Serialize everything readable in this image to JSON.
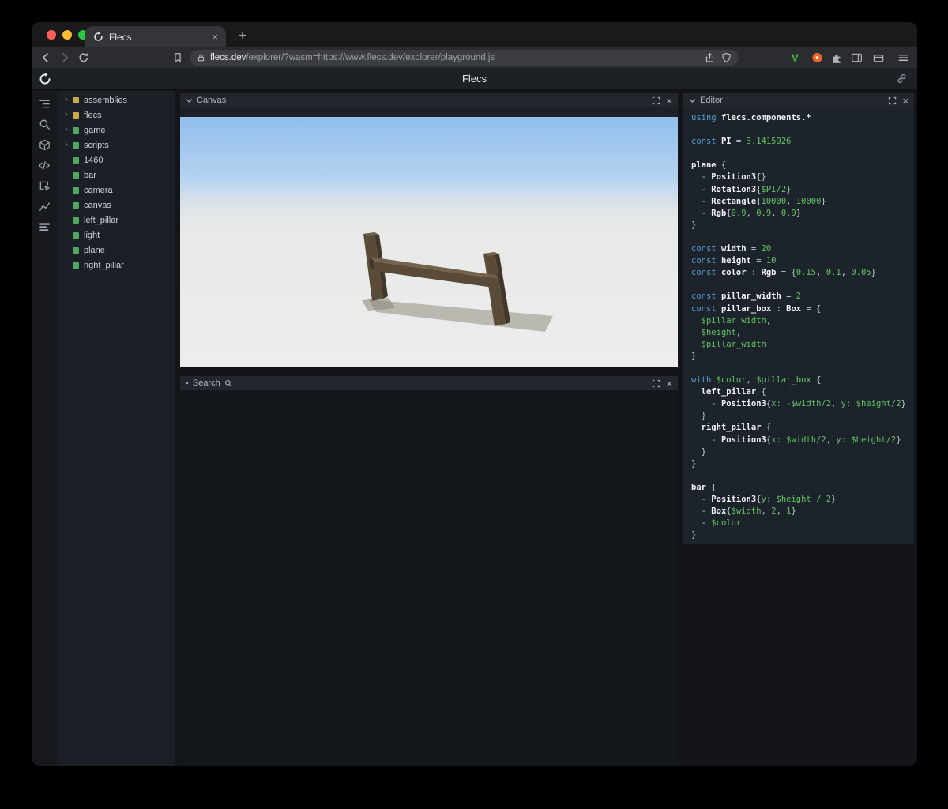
{
  "window": {
    "tab_title": "Flecs",
    "url_domain": "flecs.dev",
    "url_path": "/explorer/?wasm=https://www.flecs.dev/explorer/playground.js"
  },
  "icons": {
    "close": "×",
    "plus": "+",
    "bullet": "•",
    "chevron_right": "›",
    "v_extension": "V"
  },
  "colors": {
    "traffic_red": "#ff5f57",
    "traffic_yellow": "#febc2e",
    "traffic_green": "#28c840",
    "module_yellow": "#c9a94a",
    "entity_green": "#4fa85d",
    "accent_keyword": "#569cd6",
    "accent_value": "#62c462"
  },
  "app": {
    "title": "Flecs"
  },
  "panels": {
    "canvas": {
      "title": "Canvas"
    },
    "search": {
      "title": "Search"
    },
    "editor": {
      "title": "Editor"
    }
  },
  "tree": {
    "items": [
      {
        "label": "assemblies",
        "expandable": true,
        "color": "#c9a94a"
      },
      {
        "label": "flecs",
        "expandable": true,
        "color": "#c9a94a"
      },
      {
        "label": "game",
        "expandable": true,
        "color": "#4fa85d"
      },
      {
        "label": "scripts",
        "expandable": true,
        "color": "#4fa85d"
      },
      {
        "label": "1460",
        "expandable": false,
        "color": "#4fa85d"
      },
      {
        "label": "bar",
        "expandable": false,
        "color": "#4fa85d"
      },
      {
        "label": "camera",
        "expandable": false,
        "color": "#4fa85d"
      },
      {
        "label": "canvas",
        "expandable": false,
        "color": "#4fa85d"
      },
      {
        "label": "left_pillar",
        "expandable": false,
        "color": "#4fa85d"
      },
      {
        "label": "light",
        "expandable": false,
        "color": "#4fa85d"
      },
      {
        "label": "plane",
        "expandable": false,
        "color": "#4fa85d"
      },
      {
        "label": "right_pillar",
        "expandable": false,
        "color": "#4fa85d"
      }
    ]
  },
  "scene": {
    "sky_top": "#92bfec",
    "sky_mid": "#b4d2f1",
    "horizon": "#d8e1ea",
    "ground": "#e7e9e9",
    "ground_bottom": "#ecedec",
    "wood_light": "#73634a",
    "wood_mid": "#5a4b38",
    "wood_dark": "#42372a",
    "shadow": "#8a8577"
  },
  "editor": {
    "code": [
      [
        {
          "t": "using ",
          "c": "k"
        },
        {
          "t": "flecs.components.*",
          "c": "n"
        }
      ],
      [],
      [
        {
          "t": "const ",
          "c": "k"
        },
        {
          "t": "PI",
          "c": "n"
        },
        {
          "t": " = ",
          "c": "p"
        },
        {
          "t": "3.1415926",
          "c": "v"
        }
      ],
      [],
      [
        {
          "t": "plane",
          "c": "n"
        },
        {
          "t": " {",
          "c": "p"
        }
      ],
      [
        {
          "t": "  - ",
          "c": "p"
        },
        {
          "t": "Position3",
          "c": "n"
        },
        {
          "t": "{}",
          "c": "p"
        }
      ],
      [
        {
          "t": "  - ",
          "c": "p"
        },
        {
          "t": "Rotation3",
          "c": "n"
        },
        {
          "t": "{",
          "c": "p"
        },
        {
          "t": "$PI/2",
          "c": "v"
        },
        {
          "t": "}",
          "c": "p"
        }
      ],
      [
        {
          "t": "  - ",
          "c": "p"
        },
        {
          "t": "Rectangle",
          "c": "n"
        },
        {
          "t": "{",
          "c": "p"
        },
        {
          "t": "10000",
          "c": "v"
        },
        {
          "t": ", ",
          "c": "p"
        },
        {
          "t": "10000",
          "c": "v"
        },
        {
          "t": "}",
          "c": "p"
        }
      ],
      [
        {
          "t": "  - ",
          "c": "p"
        },
        {
          "t": "Rgb",
          "c": "n"
        },
        {
          "t": "{",
          "c": "p"
        },
        {
          "t": "0.9",
          "c": "v"
        },
        {
          "t": ", ",
          "c": "p"
        },
        {
          "t": "0.9",
          "c": "v"
        },
        {
          "t": ", ",
          "c": "p"
        },
        {
          "t": "0.9",
          "c": "v"
        },
        {
          "t": "}",
          "c": "p"
        }
      ],
      [
        {
          "t": "}",
          "c": "p"
        }
      ],
      [],
      [
        {
          "t": "const ",
          "c": "k"
        },
        {
          "t": "width",
          "c": "n"
        },
        {
          "t": " = ",
          "c": "p"
        },
        {
          "t": "20",
          "c": "v"
        }
      ],
      [
        {
          "t": "const ",
          "c": "k"
        },
        {
          "t": "height",
          "c": "n"
        },
        {
          "t": " = ",
          "c": "p"
        },
        {
          "t": "10",
          "c": "v"
        }
      ],
      [
        {
          "t": "const ",
          "c": "k"
        },
        {
          "t": "color",
          "c": "n"
        },
        {
          "t": " : ",
          "c": "p"
        },
        {
          "t": "Rgb",
          "c": "n"
        },
        {
          "t": " = {",
          "c": "p"
        },
        {
          "t": "0.15",
          "c": "v"
        },
        {
          "t": ", ",
          "c": "p"
        },
        {
          "t": "0.1",
          "c": "v"
        },
        {
          "t": ", ",
          "c": "p"
        },
        {
          "t": "0.05",
          "c": "v"
        },
        {
          "t": "}",
          "c": "p"
        }
      ],
      [],
      [
        {
          "t": "const ",
          "c": "k"
        },
        {
          "t": "pillar_width",
          "c": "n"
        },
        {
          "t": " = ",
          "c": "p"
        },
        {
          "t": "2",
          "c": "v"
        }
      ],
      [
        {
          "t": "const ",
          "c": "k"
        },
        {
          "t": "pillar_box",
          "c": "n"
        },
        {
          "t": " : ",
          "c": "p"
        },
        {
          "t": "Box",
          "c": "n"
        },
        {
          "t": " = {",
          "c": "p"
        }
      ],
      [
        {
          "t": "  ",
          "c": "p"
        },
        {
          "t": "$pillar_width",
          "c": "v"
        },
        {
          "t": ",",
          "c": "p"
        }
      ],
      [
        {
          "t": "  ",
          "c": "p"
        },
        {
          "t": "$height",
          "c": "v"
        },
        {
          "t": ",",
          "c": "p"
        }
      ],
      [
        {
          "t": "  ",
          "c": "p"
        },
        {
          "t": "$pillar_width",
          "c": "v"
        }
      ],
      [
        {
          "t": "}",
          "c": "p"
        }
      ],
      [],
      [
        {
          "t": "with ",
          "c": "k"
        },
        {
          "t": "$color",
          "c": "v"
        },
        {
          "t": ", ",
          "c": "p"
        },
        {
          "t": "$pillar_box",
          "c": "v"
        },
        {
          "t": " {",
          "c": "p"
        }
      ],
      [
        {
          "t": "  ",
          "c": "p"
        },
        {
          "t": "left_pillar",
          "c": "n"
        },
        {
          "t": " {",
          "c": "p"
        }
      ],
      [
        {
          "t": "    - ",
          "c": "p"
        },
        {
          "t": "Position3",
          "c": "n"
        },
        {
          "t": "{",
          "c": "p"
        },
        {
          "t": "x: -$width/2",
          "c": "v"
        },
        {
          "t": ", ",
          "c": "p"
        },
        {
          "t": "y: $height/2",
          "c": "v"
        },
        {
          "t": "}",
          "c": "p"
        }
      ],
      [
        {
          "t": "  }",
          "c": "p"
        }
      ],
      [
        {
          "t": "  ",
          "c": "p"
        },
        {
          "t": "right_pillar",
          "c": "n"
        },
        {
          "t": " {",
          "c": "p"
        }
      ],
      [
        {
          "t": "    - ",
          "c": "p"
        },
        {
          "t": "Position3",
          "c": "n"
        },
        {
          "t": "{",
          "c": "p"
        },
        {
          "t": "x: $width/2",
          "c": "v"
        },
        {
          "t": ", ",
          "c": "p"
        },
        {
          "t": "y: $height/2",
          "c": "v"
        },
        {
          "t": "}",
          "c": "p"
        }
      ],
      [
        {
          "t": "  }",
          "c": "p"
        }
      ],
      [
        {
          "t": "}",
          "c": "p"
        }
      ],
      [],
      [
        {
          "t": "bar",
          "c": "n"
        },
        {
          "t": " {",
          "c": "p"
        }
      ],
      [
        {
          "t": "  - ",
          "c": "p"
        },
        {
          "t": "Position3",
          "c": "n"
        },
        {
          "t": "{",
          "c": "p"
        },
        {
          "t": "y: $height / 2",
          "c": "v"
        },
        {
          "t": "}",
          "c": "p"
        }
      ],
      [
        {
          "t": "  - ",
          "c": "p"
        },
        {
          "t": "Box",
          "c": "n"
        },
        {
          "t": "{",
          "c": "p"
        },
        {
          "t": "$width",
          "c": "v"
        },
        {
          "t": ", ",
          "c": "p"
        },
        {
          "t": "2",
          "c": "v"
        },
        {
          "t": ", ",
          "c": "p"
        },
        {
          "t": "1",
          "c": "v"
        },
        {
          "t": "}",
          "c": "p"
        }
      ],
      [
        {
          "t": "  - ",
          "c": "p"
        },
        {
          "t": "$color",
          "c": "v"
        }
      ],
      [
        {
          "t": "}",
          "c": "p"
        }
      ]
    ]
  }
}
